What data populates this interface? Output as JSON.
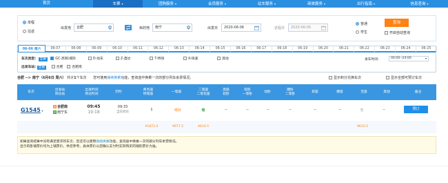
{
  "nav": [
    {
      "label": "首页",
      "caret": false,
      "active": false
    },
    {
      "label": "车票",
      "caret": true,
      "active": true
    },
    {
      "label": "团购服务",
      "caret": true,
      "active": false
    },
    {
      "label": "会员服务",
      "caret": true,
      "active": false
    },
    {
      "label": "站车服务",
      "caret": true,
      "active": false
    },
    {
      "label": "商旅服务",
      "caret": true,
      "active": false
    },
    {
      "label": "出行指南",
      "caret": true,
      "active": false
    },
    {
      "label": "信息查询",
      "caret": true,
      "active": false
    }
  ],
  "search": {
    "trip_single": "单程",
    "trip_round": "往返",
    "from_label": "出发地",
    "from_value": "合肥",
    "to_label": "目的地",
    "to_value": "南宁",
    "depart_label": "出发日",
    "depart_value": "2020-06-06",
    "return_label": "返程日",
    "return_value": "2020-06-05",
    "ticket_normal": "普通",
    "ticket_student": "学生",
    "query_button": "查询",
    "auto_query": "开启自动查询"
  },
  "dates": [
    "06-06 周六",
    "06-07",
    "06-08",
    "06-09",
    "06-10",
    "06-11",
    "06-12",
    "06-13",
    "06-14",
    "06-15",
    "06-16",
    "06-17",
    "06-18",
    "06-19",
    "06-20",
    "06-21",
    "06-22",
    "06-23",
    "06-24",
    "06-25"
  ],
  "filters": {
    "type_label": "车次类型:",
    "type_all": "全部",
    "types": [
      "GC-高铁/城际",
      "D-动车",
      "Z-直达",
      "T-特快",
      "K-快速",
      "其他"
    ],
    "station_label": "出发车站:",
    "station_all": "全部",
    "stations": [
      "合肥",
      "合肥南"
    ],
    "time_label": "发车时间:",
    "time_value": "00:00--24:00"
  },
  "result": {
    "route": "合肥 --> 南宁（6月6日 周六）",
    "count_pre": "共计",
    "count": "1",
    "count_post": "个车次",
    "hint_pre": "您可使用",
    "hint_link": "接续换乘",
    "hint_post": "功能，查询途中换乘一次的部分列车余票情况。",
    "option1": "显示积分兑换车次",
    "option2": "显示全部可预订车次"
  },
  "table_headers": [
    {
      "line1": "车次",
      "line2": ""
    },
    {
      "line1": "出发站",
      "line2": "到达站"
    },
    {
      "line1": "出发时间",
      "line2": "到达时间"
    },
    {
      "line1": "历时",
      "line2": ""
    },
    {
      "line1": "商务座",
      "line2": "特等座"
    },
    {
      "line1": "一等座",
      "line2": ""
    },
    {
      "line1": "二等座",
      "line2": "二等包座"
    },
    {
      "line1": "高级",
      "line2": "软卧"
    },
    {
      "line1": "软卧",
      "line2": "一等卧"
    },
    {
      "line1": "动卧",
      "line2": ""
    },
    {
      "line1": "硬卧",
      "line2": "二等卧"
    },
    {
      "line1": "软座",
      "line2": ""
    },
    {
      "line1": "硬座",
      "line2": ""
    },
    {
      "line1": "无座",
      "line2": ""
    },
    {
      "line1": "其他",
      "line2": ""
    },
    {
      "line1": "备注",
      "line2": ""
    }
  ],
  "train": {
    "number": "G1545",
    "from_tag": "始",
    "from_station": "合肥南",
    "to_tag": "终",
    "to_station": "南宁东",
    "depart_time": "09:45",
    "arrive_time": "19:18",
    "duration": "09:33",
    "duration_note": "当日到达",
    "business": "1",
    "first": "候补",
    "second": "有",
    "senior_soft": "--",
    "soft_sleeper": "--",
    "motor_sleeper": "--",
    "hard_sleeper": "--",
    "soft_seat": "--",
    "hard_seat": "--",
    "no_seat": "无",
    "other": "--",
    "book_button": "预订",
    "price_business": "¥1872.0",
    "price_first": "¥977.5",
    "price_second": "¥610.5",
    "price_no_seat": "¥610.5"
  },
  "notice": {
    "line1_pre": "如果查询结果中没有满足需求的车次，您还可以使用",
    "line1_link": "接续换乘",
    "line1_post": "功能，查询途中换乘一次的部分列车余票情况。",
    "line2": "显示的卧铺票价均为上铺票价，供您参考。具体票价以您确认支付时实际购买的铺别票价为准。"
  },
  "colors": {
    "nav": "#2b8fe0",
    "accent": "#ff8214",
    "header": "#3a96e0",
    "green": "#2e9a2e"
  }
}
